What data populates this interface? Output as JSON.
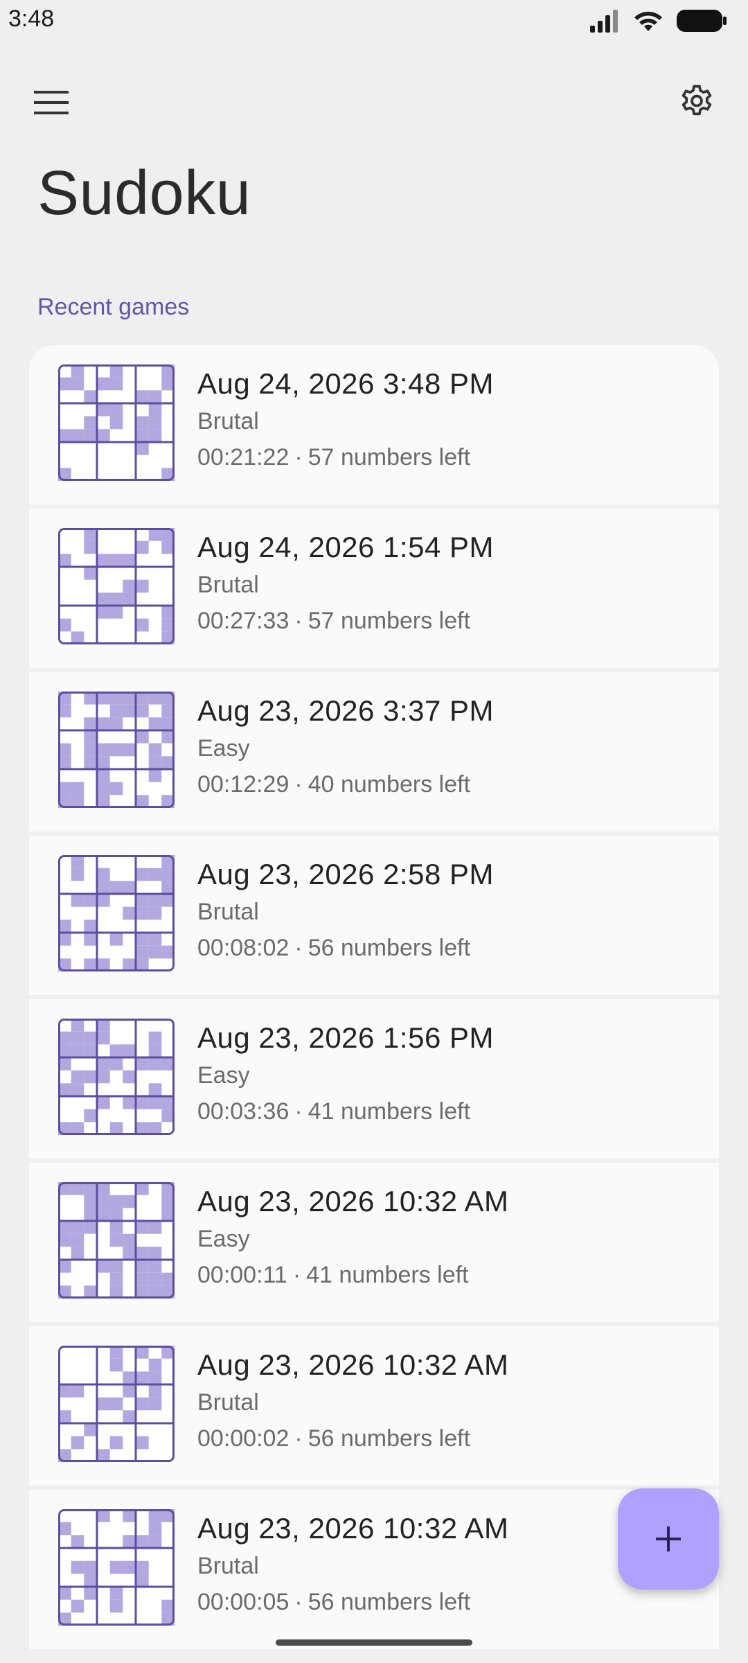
{
  "status": {
    "time": "3:48"
  },
  "app": {
    "title": "Sudoku",
    "section": "Recent games"
  },
  "colors": {
    "accent": "#6355a8",
    "grid_line": "#5b4ea0",
    "cell_fill": "#b3a7df",
    "fab": "#b0a0ff"
  },
  "icons": {
    "menu": "hamburger-menu-icon",
    "settings": "gear-icon",
    "fab": "plus-icon"
  },
  "games": [
    {
      "date": "Aug 24, 2026 3:48 PM",
      "difficulty": "Brutal",
      "time": "00:21:22",
      "remaining": "57 numbers left",
      "seed": 3
    },
    {
      "date": "Aug 24, 2026 1:54 PM",
      "difficulty": "Brutal",
      "time": "00:27:33",
      "remaining": "57 numbers left",
      "seed": 7
    },
    {
      "date": "Aug 23, 2026 3:37 PM",
      "difficulty": "Easy",
      "time": "00:12:29",
      "remaining": "40 numbers left",
      "seed": 11
    },
    {
      "date": "Aug 23, 2026 2:58 PM",
      "difficulty": "Brutal",
      "time": "00:08:02",
      "remaining": "56 numbers left",
      "seed": 19
    },
    {
      "date": "Aug 23, 2026 1:56 PM",
      "difficulty": "Easy",
      "time": "00:03:36",
      "remaining": "41 numbers left",
      "seed": 23
    },
    {
      "date": "Aug 23, 2026 10:32 AM",
      "difficulty": "Easy",
      "time": "00:00:11",
      "remaining": "41 numbers left",
      "seed": 29
    },
    {
      "date": "Aug 23, 2026 10:32 AM",
      "difficulty": "Brutal",
      "time": "00:00:02",
      "remaining": "56 numbers left",
      "seed": 31
    },
    {
      "date": "Aug 23, 2026 10:32 AM",
      "difficulty": "Brutal",
      "time": "00:00:05",
      "remaining": "56 numbers left",
      "seed": 37
    }
  ]
}
